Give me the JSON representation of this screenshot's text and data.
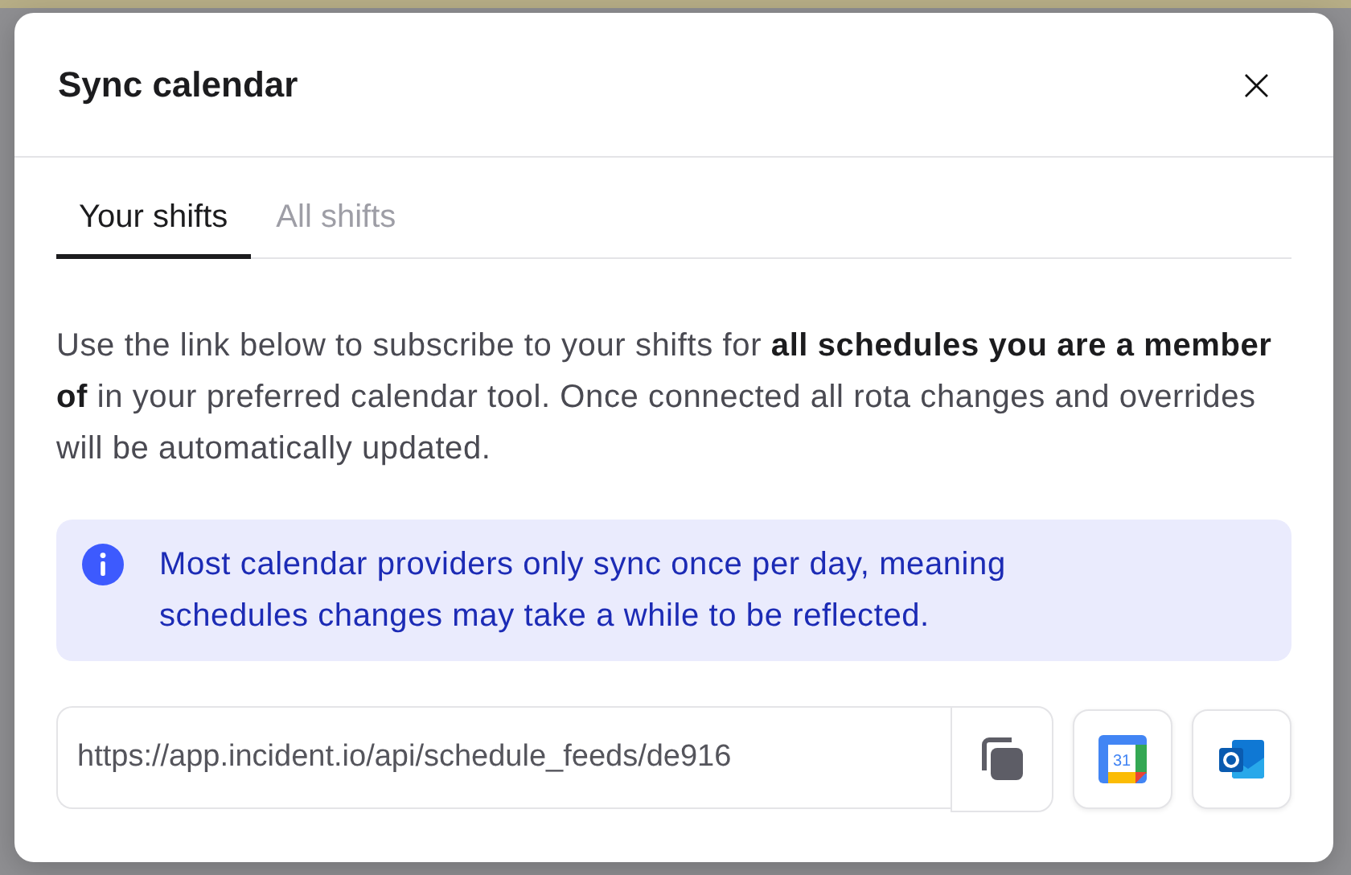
{
  "dialog": {
    "title": "Sync calendar",
    "close_label": "×",
    "tabs": [
      {
        "label": "Your shifts",
        "selected": true
      },
      {
        "label": "All shifts",
        "selected": false
      }
    ],
    "description": "Use the link below to subscribe to your shifts for **all schedules you are a member of** in your preferred calendar tool. Once connected all rota changes and overrides will be automatically updated.",
    "callout": {
      "kind": "info",
      "text": "Most calendar providers only sync once per day, meaning schedules changes may take a while to be reflected."
    },
    "feed_url": {
      "value": "https://app.incident.io/api/schedule_feeds/de916"
    },
    "actions": [
      {
        "kind": "copy"
      },
      {
        "kind": "google",
        "label": "31"
      },
      {
        "kind": "outlook"
      }
    ]
  }
}
